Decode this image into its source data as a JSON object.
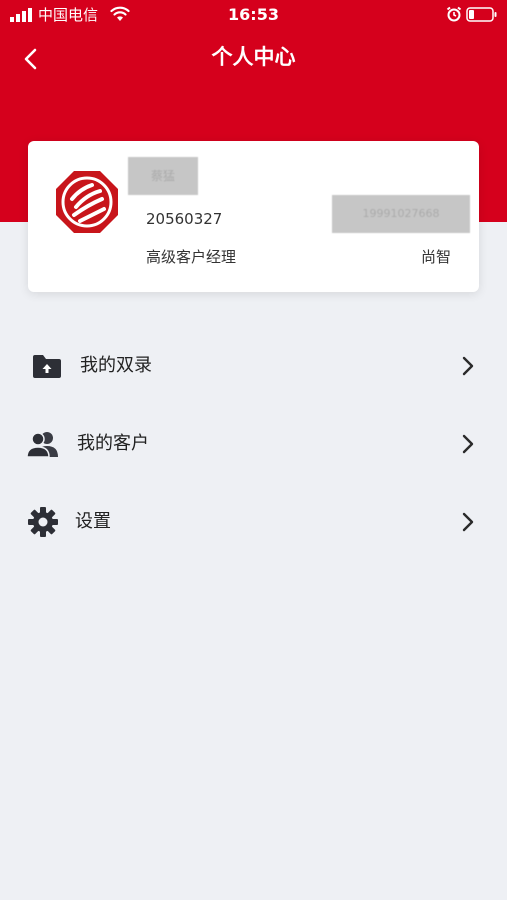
{
  "status_bar": {
    "carrier": "中国电信",
    "time": "16:53"
  },
  "nav": {
    "title": "个人中心"
  },
  "profile": {
    "name_redacted": "蔡猛",
    "employee_id": "20560327",
    "phone_redacted": "19991027668",
    "position": "高级客户经理",
    "branch": "尚智"
  },
  "menu": {
    "items": [
      {
        "label": "我的双录",
        "icon": "folder-upload-icon"
      },
      {
        "label": "我的客户",
        "icon": "users-icon"
      },
      {
        "label": "设置",
        "icon": "gear-icon"
      }
    ]
  },
  "colors": {
    "brand_red": "#d5001c",
    "background": "#eef0f4"
  }
}
